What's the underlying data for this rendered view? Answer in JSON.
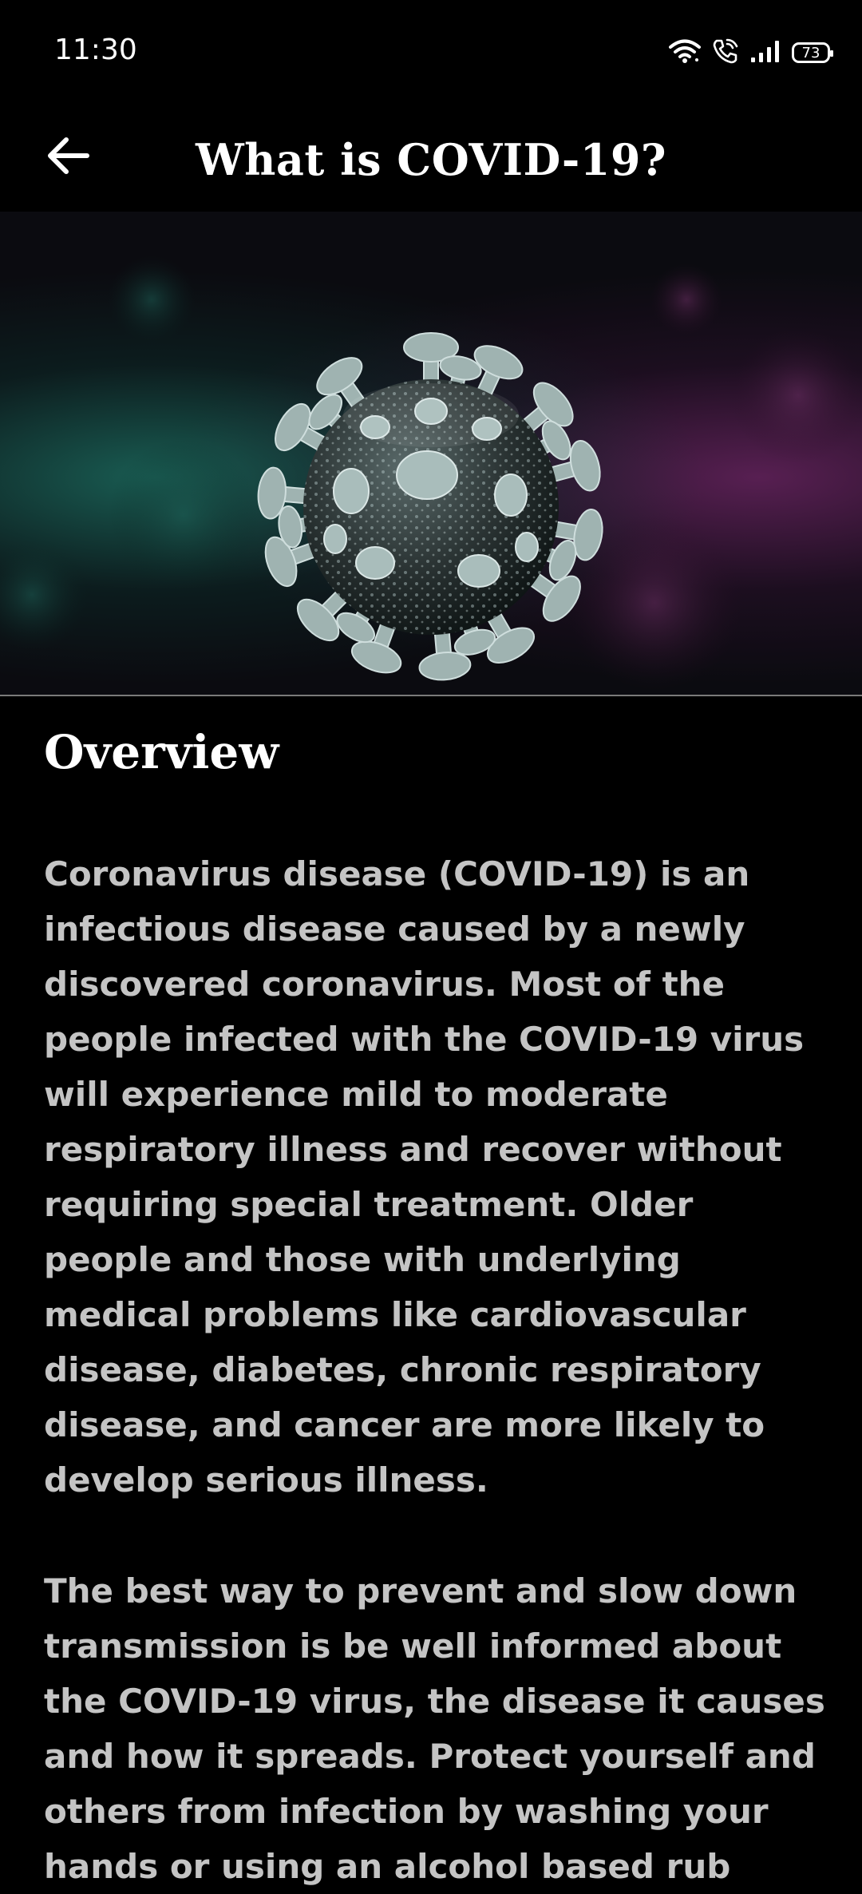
{
  "status_bar": {
    "time": "11:30",
    "icons": [
      "wifi-icon",
      "wifi-calling-icon",
      "signal-icon",
      "battery-icon"
    ],
    "battery_level": "73"
  },
  "app_bar": {
    "back_icon": "arrow-left-icon",
    "title": "What is COVID-19?"
  },
  "hero": {
    "image": "coronavirus-3d-render",
    "colors": {
      "teal_glow": "#1e7869",
      "magenta_glow": "#782870",
      "virus": "#9fb3b1"
    }
  },
  "content": {
    "section_title": "Overview",
    "paragraphs": [
      "Coronavirus disease (COVID-19) is an infectious disease caused by a newly discovered coronavirus. Most of the people infected with the COVID-19 virus will experience mild to moderate respiratory illness and recover without requiring special treatment. Older people and those with underlying medical problems like cardiovascular disease, diabetes, chronic respiratory disease, and cancer are more likely to develop serious illness.",
      "The best way to prevent and slow down transmission is be well informed about the COVID-19 virus, the disease it causes and how it spreads. Protect yourself and others from infection by washing your hands or using an alcohol based rub"
    ]
  },
  "colors": {
    "background": "#000000",
    "title": "#ffffff",
    "body_text": "#c4c4c4"
  }
}
